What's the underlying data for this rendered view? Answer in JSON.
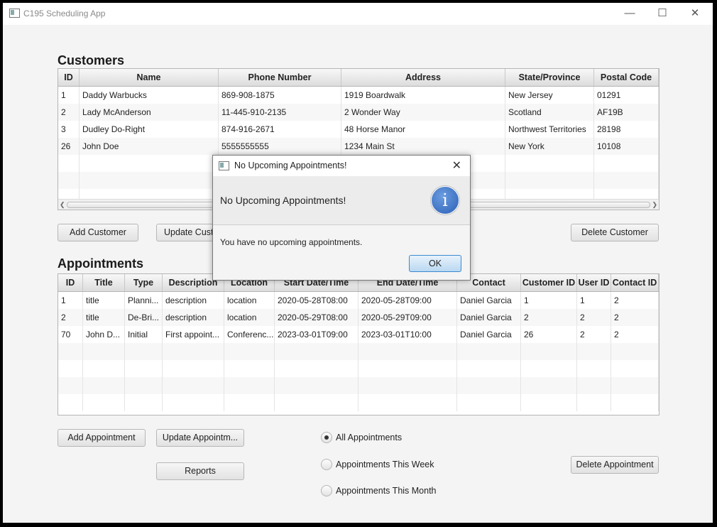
{
  "window": {
    "title": "C195 Scheduling App"
  },
  "customers": {
    "heading": "Customers",
    "columns": [
      "ID",
      "Name",
      "Phone Number",
      "Address",
      "State/Province",
      "Postal Code"
    ],
    "rows": [
      [
        "1",
        "Daddy Warbucks",
        "869-908-1875",
        "1919 Boardwalk",
        "New Jersey",
        "01291"
      ],
      [
        "2",
        "Lady McAnderson",
        "11-445-910-2135",
        "2 Wonder Way",
        "Scotland",
        "AF19B"
      ],
      [
        "3",
        "Dudley Do-Right",
        "874-916-2671",
        "48 Horse Manor",
        "Northwest Territories",
        "28198"
      ],
      [
        "26",
        "John Doe",
        "5555555555",
        "1234 Main St",
        "New York",
        "10108"
      ]
    ],
    "buttons": {
      "add": "Add Customer",
      "update": "Update Customer",
      "delete": "Delete Customer"
    }
  },
  "appointments": {
    "heading": "Appointments",
    "columns": [
      "ID",
      "Title",
      "Type",
      "Description",
      "Location",
      "Start Date/Time",
      "End Date/Time",
      "Contact",
      "Customer ID",
      "User ID",
      "Contact ID"
    ],
    "rows": [
      [
        "1",
        "title",
        "Planni...",
        "description",
        "location",
        "2020-05-28T08:00",
        "2020-05-28T09:00",
        "Daniel Garcia",
        "1",
        "1",
        "2"
      ],
      [
        "2",
        "title",
        "De-Bri...",
        "description",
        "location",
        "2020-05-29T08:00",
        "2020-05-29T09:00",
        "Daniel Garcia",
        "2",
        "2",
        "2"
      ],
      [
        "70",
        "John D...",
        "Initial",
        "First appoint...",
        "Conferenc...",
        "2023-03-01T09:00",
        "2023-03-01T10:00",
        "Daniel Garcia",
        "26",
        "2",
        "2"
      ]
    ],
    "buttons": {
      "add": "Add Appointment",
      "update": "Update Appointm...",
      "reports": "Reports",
      "delete": "Delete Appointment"
    },
    "filters": {
      "all": "All Appointments",
      "week": "Appointments This Week",
      "month": "Appointments This Month",
      "selected": "all"
    }
  },
  "dialog": {
    "title": "No Upcoming Appointments!",
    "header": "No Upcoming Appointments!",
    "content": "You have no upcoming appointments.",
    "ok": "OK",
    "icon": "info-icon"
  },
  "colors": {
    "accent": "#2a5fb5",
    "ok_border": "#3a8ad0"
  }
}
